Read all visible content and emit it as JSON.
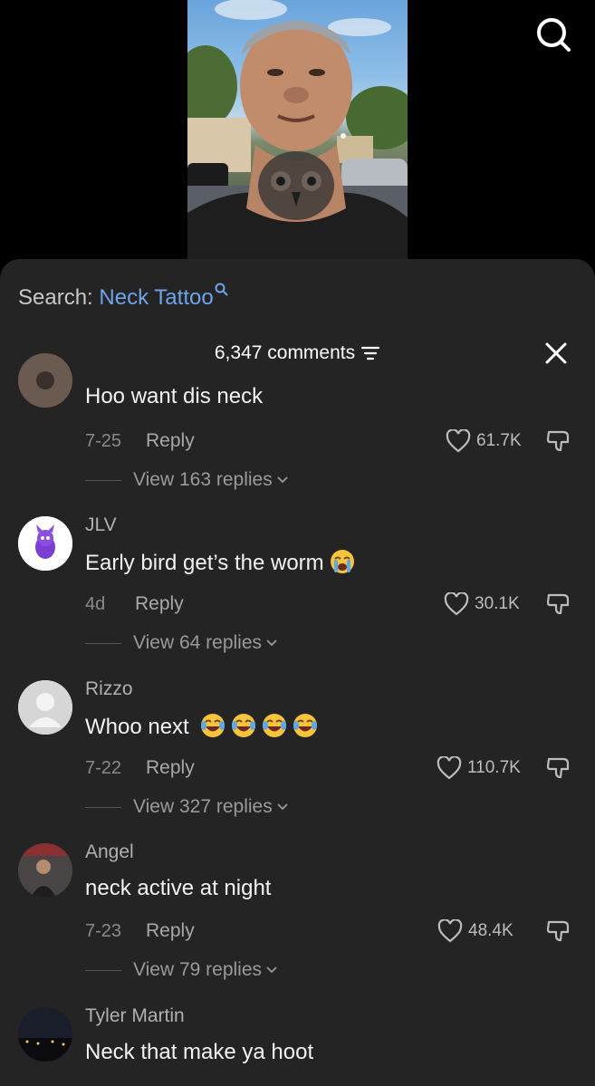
{
  "search": {
    "prefix": "Search:",
    "term": "Neck Tattoo"
  },
  "header": {
    "count": "6,347 comments"
  },
  "comments": [
    {
      "username": "",
      "text": "Hoo want dis neck",
      "date": "7-25",
      "reply_label": "Reply",
      "likes": "61.7K",
      "view_replies": "View 163 replies"
    },
    {
      "username": "JLV",
      "text": "Early bird get’s the worm",
      "emoji": "loudly-crying-face",
      "date": "4d",
      "reply_label": "Reply",
      "likes": "30.1K",
      "view_replies": "View 64 replies"
    },
    {
      "username": "Rizzo",
      "text": "Whoo next",
      "emoji": "face-with-tears-of-joy",
      "date": "7-22",
      "reply_label": "Reply",
      "likes": "110.7K",
      "view_replies": "View 327 replies"
    },
    {
      "username": "Angel",
      "text": "neck active at night",
      "date": "7-23",
      "reply_label": "Reply",
      "likes": "48.4K",
      "view_replies": "View 79 replies"
    },
    {
      "username": "Tyler Martin",
      "text": "Neck that make ya hoot"
    }
  ],
  "colors": {
    "sheet_bg": "#242424",
    "search_term": "#6ea4ea",
    "muted_text": "#8a8a8a"
  }
}
